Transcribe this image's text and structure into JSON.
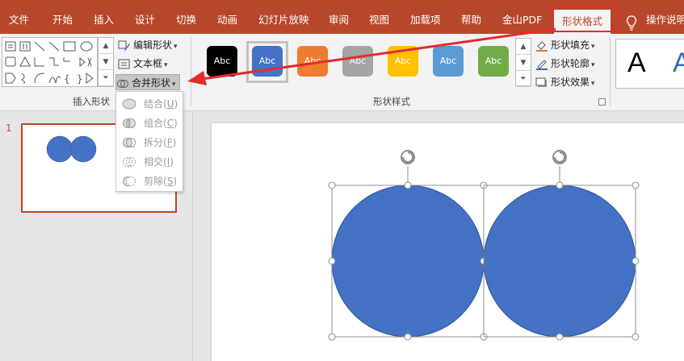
{
  "tabs": [
    {
      "label": "文件",
      "active": false
    },
    {
      "label": "开始",
      "active": false
    },
    {
      "label": "插入",
      "active": false
    },
    {
      "label": "设计",
      "active": false
    },
    {
      "label": "切换",
      "active": false
    },
    {
      "label": "动画",
      "active": false
    },
    {
      "label": "幻灯片放映",
      "active": false
    },
    {
      "label": "审阅",
      "active": false
    },
    {
      "label": "视图",
      "active": false
    },
    {
      "label": "加载项",
      "active": false
    },
    {
      "label": "帮助",
      "active": false
    },
    {
      "label": "金山PDF",
      "active": false
    },
    {
      "label": "形状格式",
      "active": true
    },
    {
      "label": "操作说明",
      "active": false
    }
  ],
  "ribbon": {
    "insert_shapes": {
      "group_label": "插入形状",
      "edit_shape": "编辑形状",
      "text_box": "文本框",
      "merge_shapes": "合并形状"
    },
    "shape_styles": {
      "group_label": "形状样式",
      "tiles": [
        {
          "label": "Abc",
          "color": "#000000"
        },
        {
          "label": "Abc",
          "color": "#4472c4",
          "selected": true
        },
        {
          "label": "Abc",
          "color": "#ed7d31"
        },
        {
          "label": "Abc",
          "color": "#a5a5a5"
        },
        {
          "label": "Abc",
          "color": "#ffc000"
        },
        {
          "label": "Abc",
          "color": "#5b9bd5"
        },
        {
          "label": "Abc",
          "color": "#70ad47"
        }
      ],
      "fill": "形状填充",
      "outline": "形状轮廓",
      "effects": "形状效果"
    },
    "wordart": {
      "sample_black": "A",
      "sample_blue": "A"
    }
  },
  "merge_menu": {
    "items": [
      {
        "label": "结合(",
        "key": "U",
        "suffix": ")"
      },
      {
        "label": "组合(",
        "key": "C",
        "suffix": ")"
      },
      {
        "label": "拆分(",
        "key": "F",
        "suffix": ")"
      },
      {
        "label": "相交(",
        "key": "I",
        "suffix": ")"
      },
      {
        "label": "剪除(",
        "key": "S",
        "suffix": ")"
      }
    ]
  },
  "slides_pane": {
    "slide_number": "1"
  },
  "colors": {
    "accent": "#b7472a",
    "shape_fill": "#4472c4",
    "annotation": "#e52b2b"
  }
}
